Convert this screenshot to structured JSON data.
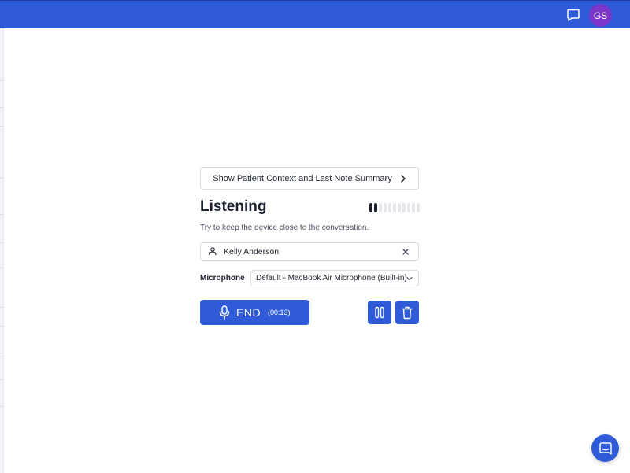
{
  "header": {
    "user_initials": "GS",
    "chat_icon": "chat-bubble-icon",
    "color": "#2f5bd8",
    "avatar_color": "#7a36c9"
  },
  "session": {
    "context_button_label": "Show Patient Context and Last Note Summary",
    "status_title": "Listening",
    "hint": "Try to keep the device close to the conversation.",
    "audio_level": {
      "active_bars": 2,
      "total_bars": 11
    }
  },
  "patient": {
    "name": "Kelly Anderson",
    "clear_icon": "close-icon"
  },
  "microphone": {
    "label": "Microphone",
    "selected": "Default - MacBook Air Microphone (Built-in)"
  },
  "controls": {
    "end_label": "END",
    "timer": "(00:13)",
    "pause_icon": "pause-icon",
    "delete_icon": "trash-icon"
  },
  "support": {
    "icon": "chat-widget-icon"
  }
}
